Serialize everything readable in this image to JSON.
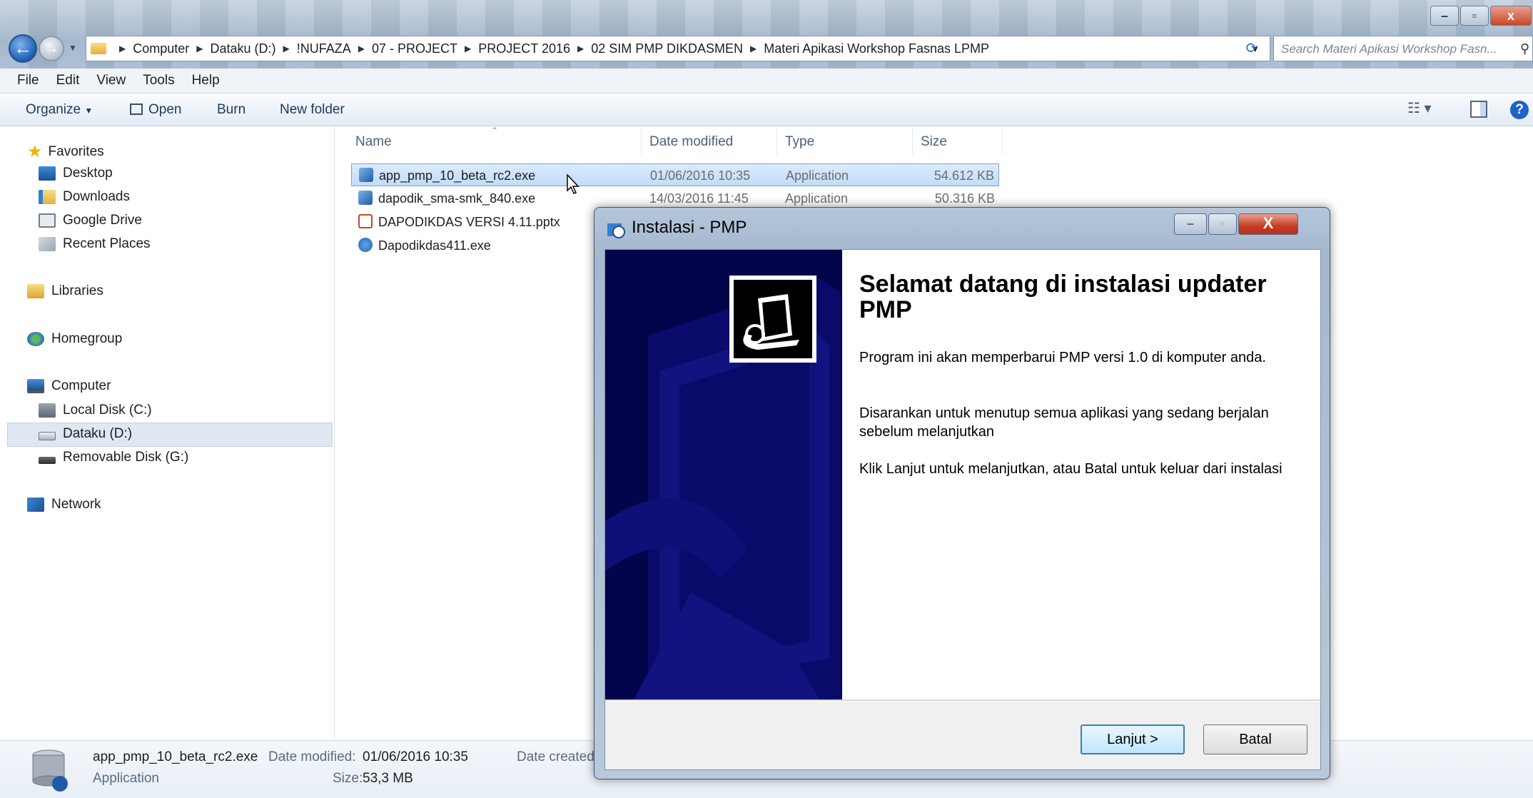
{
  "explorer": {
    "address": {
      "crumbs": [
        "Computer",
        "Dataku (D:)",
        "!NUFAZA",
        "07 - PROJECT",
        "PROJECT 2016",
        "02 SIM PMP DIKDASMEN",
        "Materi Apikasi Workshop Fasnas LPMP"
      ]
    },
    "search_placeholder": "Search Materi Apikasi Workshop Fasn...",
    "menu": [
      "File",
      "Edit",
      "View",
      "Tools",
      "Help"
    ],
    "toolbar": {
      "organize": "Organize",
      "open": "Open",
      "burn": "Burn",
      "new_folder": "New folder"
    },
    "nav": {
      "favorites": "Favorites",
      "desktop": "Desktop",
      "downloads": "Downloads",
      "google_drive": "Google Drive",
      "recent_places": "Recent Places",
      "libraries": "Libraries",
      "homegroup": "Homegroup",
      "computer": "Computer",
      "local_disk": "Local Disk (C:)",
      "dataku": "Dataku (D:)",
      "removable": "Removable Disk (G:)",
      "network": "Network"
    },
    "columns": {
      "name": "Name",
      "date": "Date modified",
      "type": "Type",
      "size": "Size"
    },
    "files": [
      {
        "name": "app_pmp_10_beta_rc2.exe",
        "date": "01/06/2016 10:35",
        "type": "Application",
        "size": "54.612 KB"
      },
      {
        "name": "dapodik_sma-smk_840.exe",
        "date": "14/03/2016 11:45",
        "type": "Application",
        "size": "50.316 KB"
      },
      {
        "name": "DAPODIKDAS VERSI 4.11.pptx",
        "date": "",
        "type": "",
        "size": ""
      },
      {
        "name": "Dapodikdas411.exe",
        "date": "",
        "type": "",
        "size": ""
      }
    ],
    "details": {
      "name": "app_pmp_10_beta_rc2.exe",
      "type": "Application",
      "date_modified_label": "Date modified:",
      "date_modified": "01/06/2016 10:35",
      "size_label": "Size:",
      "size": "53,3 MB",
      "date_created_label": "Date created:"
    }
  },
  "installer": {
    "title": "Instalasi - PMP",
    "heading": "Selamat datang di instalasi updater PMP",
    "para1": "Program ini akan memperbarui PMP versi 1.0 di komputer anda.",
    "para2": "Disarankan untuk menutup semua aplikasi yang sedang berjalan sebelum melanjutkan",
    "para3": "Klik Lanjut untuk melanjutkan, atau Batal untuk keluar dari instalasi",
    "next_label": "Lanjut >",
    "cancel_label": "Batal"
  },
  "colors": {
    "banner": "#04044a",
    "selection": "#cce4fb",
    "accent": "#3c7fb1"
  }
}
